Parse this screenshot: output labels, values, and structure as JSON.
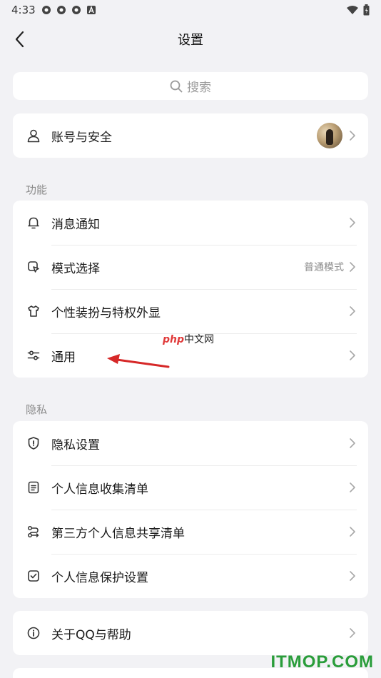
{
  "status_bar": {
    "time": "4:33"
  },
  "nav": {
    "title": "设置"
  },
  "search": {
    "placeholder": "搜索"
  },
  "account": {
    "label": "账号与安全"
  },
  "sections": {
    "features": {
      "title": "功能",
      "items": [
        {
          "label": "消息通知",
          "value": ""
        },
        {
          "label": "模式选择",
          "value": "普通模式"
        },
        {
          "label": "个性装扮与特权外显",
          "value": ""
        },
        {
          "label": "通用",
          "value": ""
        }
      ]
    },
    "privacy": {
      "title": "隐私",
      "items": [
        {
          "label": "隐私设置"
        },
        {
          "label": "个人信息收集清单"
        },
        {
          "label": "第三方个人信息共享清单"
        },
        {
          "label": "个人信息保护设置"
        }
      ]
    }
  },
  "about": {
    "label": "关于QQ与帮助"
  },
  "watermark": {
    "brand": "php",
    "suffix": "中文网"
  },
  "site_mark": "ITMOP.COM",
  "colors": {
    "background": "#f2f2f5",
    "card": "#ffffff",
    "annotation_arrow": "#d62828",
    "site_mark": "#2a9d3a"
  }
}
